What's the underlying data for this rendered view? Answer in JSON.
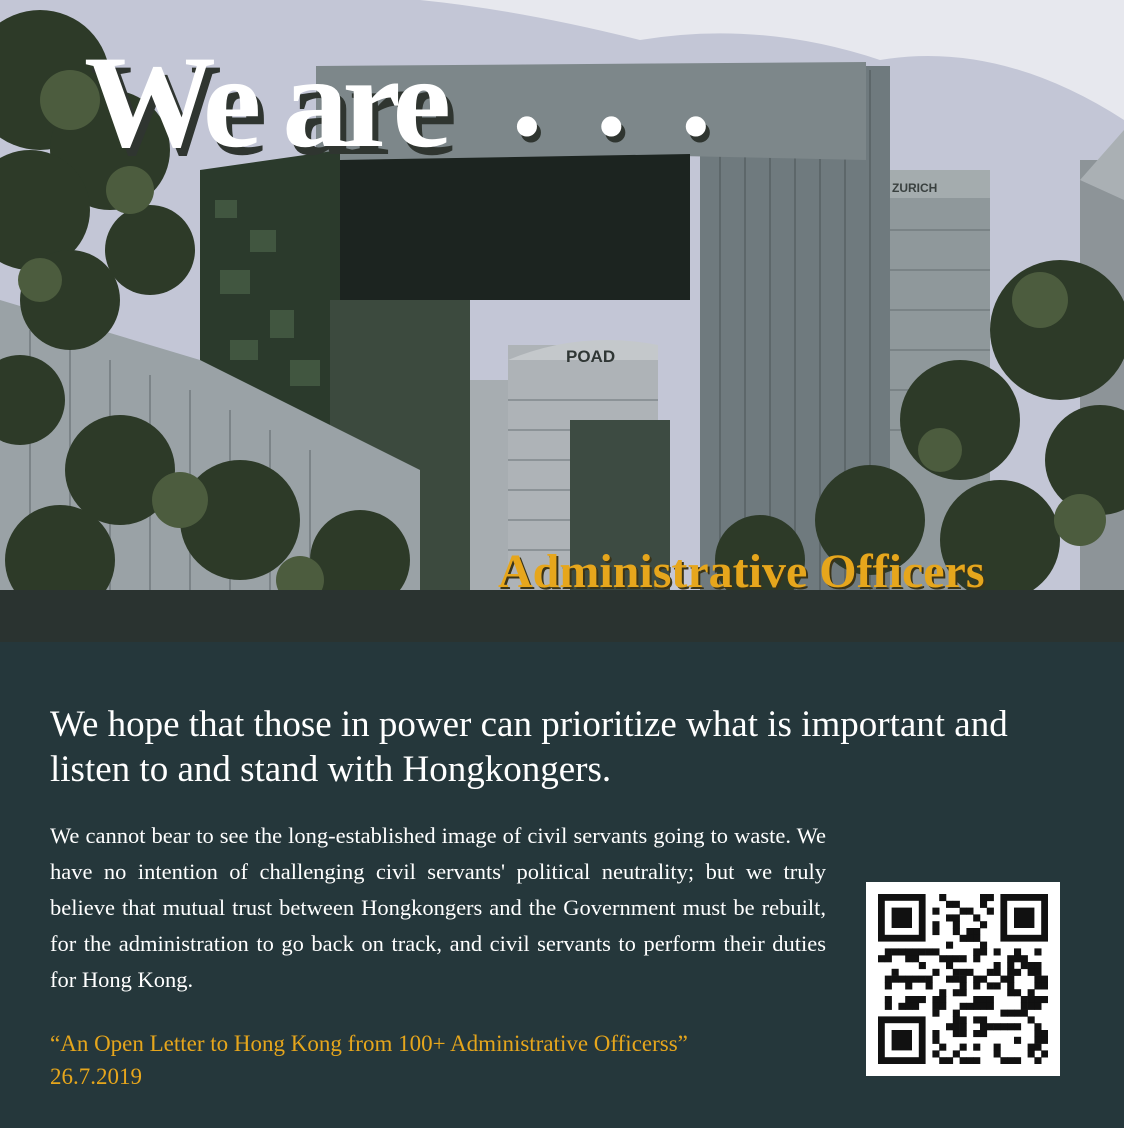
{
  "hero": {
    "headline": "We are",
    "headline_dots": "• • •",
    "role_title": "Administrative Officers",
    "sign_text": "POAD",
    "sign_text_2": "ZURICH"
  },
  "message": {
    "lead": "We hope that those in power can prioritize what is important and listen to and stand with Hongkongers.",
    "body": "We cannot bear to see the long-established image of civil servants going to waste. We have no intention of challenging civil servants' political neutrality; but we truly believe that mutual trust between Hongkongers and the Government must be rebuilt, for the administration to go back on track, and civil servants to perform their duties for Hong Kong.",
    "source_title": "“An Open Letter to Hong Kong from 100+ Administrative Officerss”",
    "source_date": "26.7.2019"
  },
  "qr_code": {
    "icon": "qr-code-icon"
  },
  "colors": {
    "accent": "#e6a61c",
    "panel_background": "#25373b",
    "text": "#ffffff"
  }
}
